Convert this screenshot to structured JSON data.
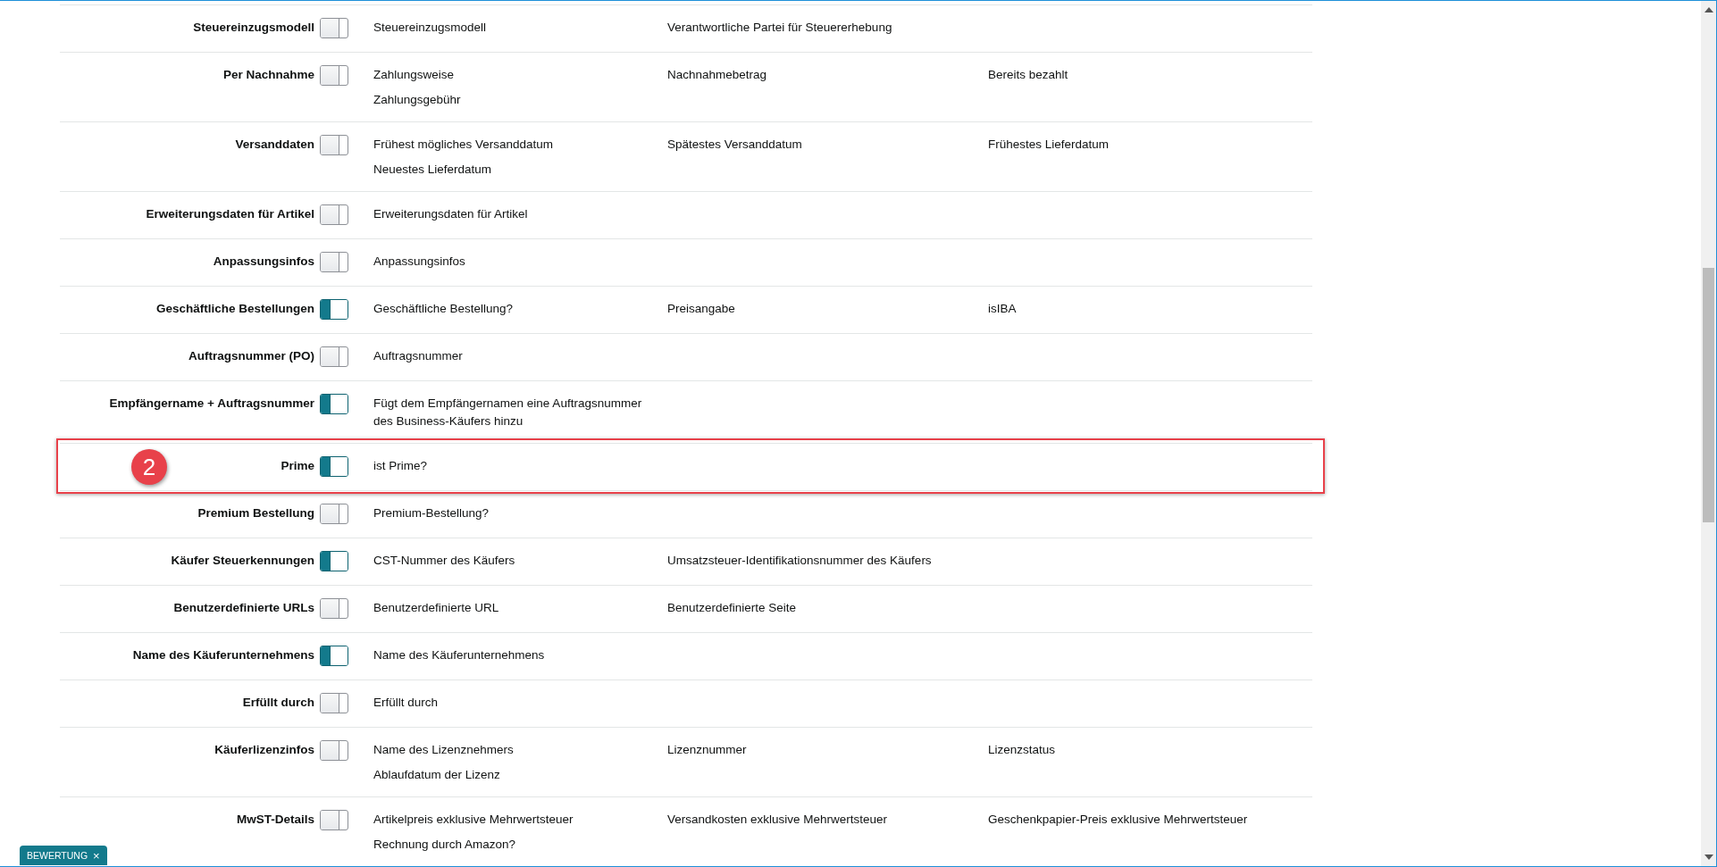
{
  "rows": [
    {
      "label": "Steuereinzugsmodell",
      "on": false,
      "highlighted": false,
      "columns": [
        [
          "Steuereinzugsmodell"
        ],
        [
          "Verantwortliche Partei für Steuererhebung"
        ],
        []
      ]
    },
    {
      "label": "Per Nachnahme",
      "on": false,
      "highlighted": false,
      "columns": [
        [
          "Zahlungsweise",
          "Zahlungsgebühr"
        ],
        [
          "Nachnahmebetrag"
        ],
        [
          "Bereits bezahlt"
        ]
      ]
    },
    {
      "label": "Versanddaten",
      "on": false,
      "highlighted": false,
      "columns": [
        [
          "Frühest mögliches Versanddatum",
          "Neuestes Lieferdatum"
        ],
        [
          "Spätestes Versanddatum"
        ],
        [
          "Frühestes Lieferdatum"
        ]
      ]
    },
    {
      "label": "Erweiterungsdaten für Artikel",
      "on": false,
      "highlighted": false,
      "columns": [
        [
          "Erweiterungsdaten für Artikel"
        ],
        [],
        []
      ]
    },
    {
      "label": "Anpassungsinfos",
      "on": false,
      "highlighted": false,
      "columns": [
        [
          "Anpassungsinfos"
        ],
        [],
        []
      ]
    },
    {
      "label": "Geschäftliche Bestellungen",
      "on": true,
      "highlighted": false,
      "columns": [
        [
          "Geschäftliche Bestellung?"
        ],
        [
          "Preisangabe"
        ],
        [
          "isIBA"
        ]
      ]
    },
    {
      "label": "Auftragsnummer (PO)",
      "on": false,
      "highlighted": false,
      "columns": [
        [
          "Auftragsnummer"
        ],
        [],
        []
      ]
    },
    {
      "label": "Empfängername + Auftragsnummer",
      "on": true,
      "highlighted": false,
      "columns": [
        [
          "Fügt dem Empfängernamen eine Auftragsnummer des Business-Käufers hinzu"
        ],
        [],
        []
      ]
    },
    {
      "label": "Prime",
      "on": true,
      "highlighted": true,
      "callout": "2",
      "columns": [
        [
          "ist Prime?"
        ],
        [],
        []
      ]
    },
    {
      "label": "Premium Bestellung",
      "on": false,
      "highlighted": false,
      "columns": [
        [
          "Premium-Bestellung?"
        ],
        [],
        []
      ]
    },
    {
      "label": "Käufer Steuerkennungen",
      "on": true,
      "highlighted": false,
      "columns": [
        [
          "CST-Nummer des Käufers"
        ],
        [
          "Umsatzsteuer-Identifikationsnummer des Käufers"
        ],
        []
      ]
    },
    {
      "label": "Benutzerdefinierte URLs",
      "on": false,
      "highlighted": false,
      "columns": [
        [
          "Benutzerdefinierte URL"
        ],
        [
          "Benutzerdefinierte Seite"
        ],
        []
      ]
    },
    {
      "label": "Name des Käuferunternehmens",
      "on": true,
      "highlighted": false,
      "columns": [
        [
          "Name des Käuferunternehmens"
        ],
        [],
        []
      ]
    },
    {
      "label": "Erfüllt durch",
      "on": false,
      "highlighted": false,
      "columns": [
        [
          "Erfüllt durch"
        ],
        [],
        []
      ]
    },
    {
      "label": "Käuferlizenzinfos",
      "on": false,
      "highlighted": false,
      "columns": [
        [
          "Name des Lizenznehmers",
          "Ablaufdatum der Lizenz"
        ],
        [
          "Lizenznummer"
        ],
        [
          "Lizenzstatus"
        ]
      ]
    },
    {
      "label": "MwST-Details",
      "on": false,
      "highlighted": false,
      "columns": [
        [
          "Artikelpreis exklusive Mehrwertsteuer",
          "Rechnung durch Amazon?"
        ],
        [
          "Versandkosten exklusive Mehrwertsteuer"
        ],
        [
          "Geschenkpapier-Preis exklusive Mehrwertsteuer"
        ]
      ]
    }
  ],
  "feedback_tab": {
    "label": "BEWERTUNG",
    "close": "×"
  }
}
